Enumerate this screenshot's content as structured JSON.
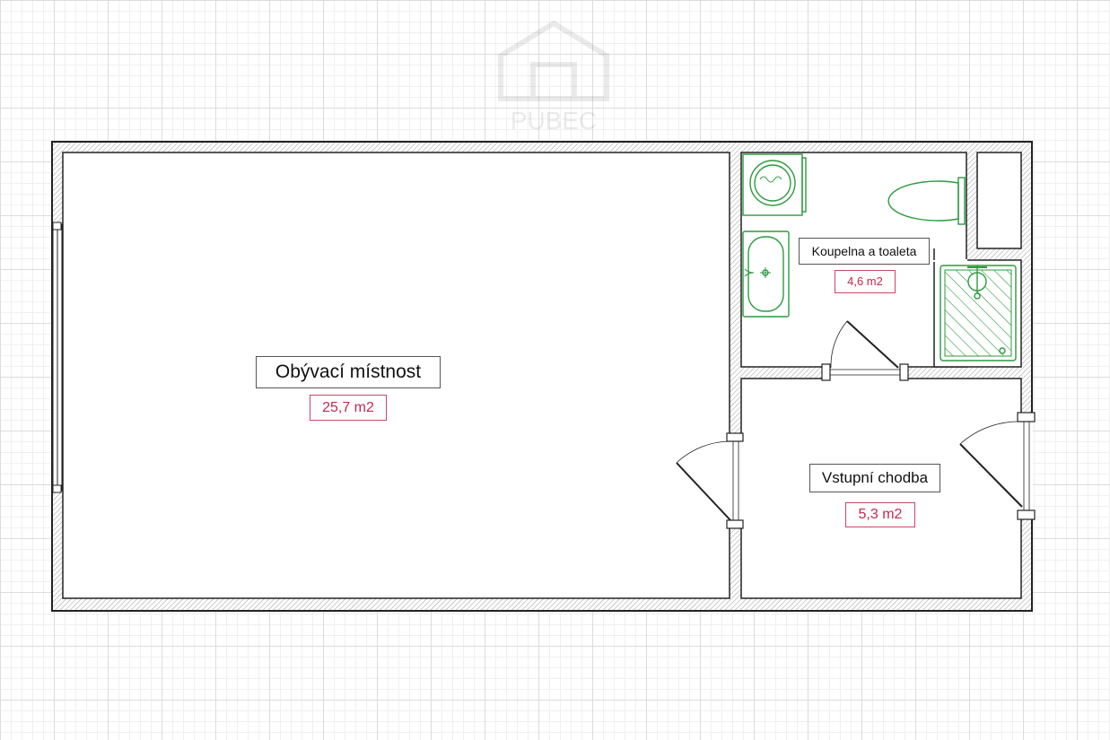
{
  "rooms": {
    "living_room": {
      "name": "Obývací místnost",
      "area": "25,7 m2"
    },
    "bathroom": {
      "name": "Koupelna a toaleta",
      "area": "4,6 m2"
    },
    "hallway": {
      "name": "Vstupní chodba",
      "area": "5,3 m2"
    }
  },
  "watermark": {
    "text": "PUBEC"
  },
  "colors": {
    "wall_fill": "#ffffff",
    "wall_stroke": "#222222",
    "fixture_green": "#2c9a3e",
    "area_text": "#c8264f",
    "grid_major": "#dcdcdc",
    "grid_minor": "#f0f0f0"
  },
  "icons": [
    "washing-machine-icon",
    "toilet-icon",
    "sink-icon",
    "shower-icon",
    "door-icon",
    "window-icon",
    "house-logo-icon"
  ]
}
